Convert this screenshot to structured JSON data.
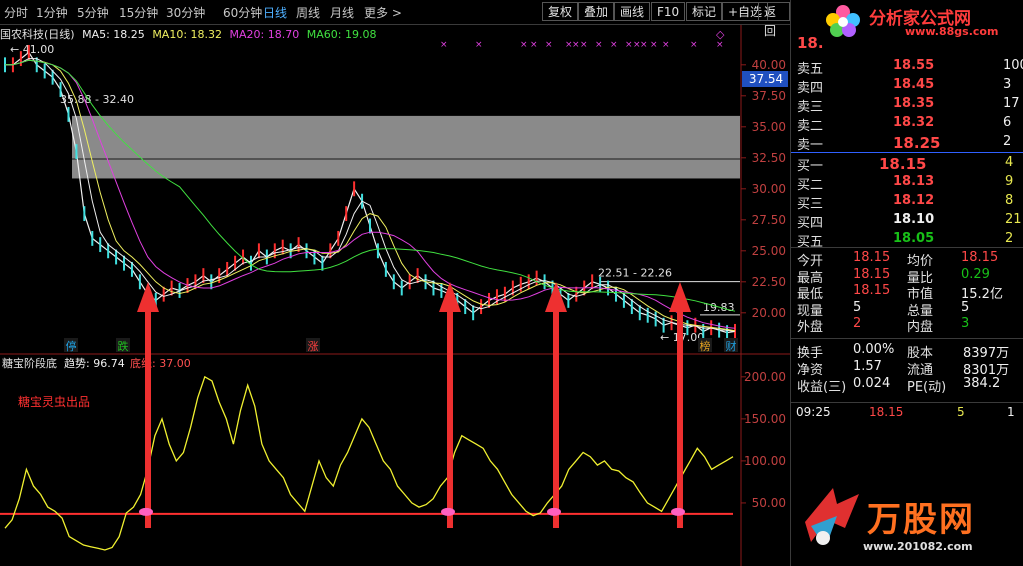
{
  "toolbar": {
    "periods": [
      "分时",
      "1分钟",
      "5分钟",
      "15分钟",
      "30分钟",
      "60分钟",
      "日线",
      "周线",
      "月线",
      "更多 >"
    ],
    "active_period": "日线",
    "buttons": [
      "复权",
      "叠加",
      "画线",
      "F10",
      "标记",
      "+自选",
      "返回"
    ]
  },
  "header": {
    "stock": "国农科技(日线)",
    "ma5": "MA5: 18.25",
    "ma10": "MA10: 18.32",
    "ma20": "MA20: 18.70",
    "ma60": "MA60: 19.08"
  },
  "price_axis": {
    "ticks": [
      "40.00",
      "37.50",
      "35.00",
      "32.50",
      "30.00",
      "27.50",
      "25.00",
      "22.50",
      "20.00"
    ],
    "current_price_tag": "37.54",
    "ylim": [
      17.0,
      42.0
    ]
  },
  "annotations": {
    "high": "41.00",
    "low": "17.00",
    "box_range": "35.88 - 32.40",
    "range2": "22.51 - 22.26",
    "last_high": "19.83",
    "markers": [
      "停",
      "跌",
      "涨",
      "榜",
      "财"
    ]
  },
  "indicator": {
    "title": "糖宝阶段底",
    "trend": "趋势: 96.74",
    "line": "底线: 37.00",
    "credit": "糖宝灵虫出品",
    "ticks": [
      "200.00",
      "150.00",
      "100.00",
      "50.00"
    ],
    "ylim": [
      -25,
      220
    ],
    "baseline": 37
  },
  "chart_data": {
    "type": "line",
    "series": [
      {
        "name": "趋势",
        "values": [
          20,
          30,
          55,
          90,
          70,
          60,
          45,
          40,
          32,
          10,
          5,
          0,
          -2,
          -4,
          -6,
          -3,
          10,
          38,
          45,
          60,
          90,
          130,
          150,
          120,
          100,
          110,
          140,
          175,
          200,
          195,
          170,
          150,
          120,
          160,
          190,
          165,
          120,
          100,
          90,
          80,
          60,
          50,
          40,
          70,
          100,
          80,
          70,
          95,
          110,
          130,
          150,
          140,
          120,
          100,
          90,
          70,
          60,
          50,
          45,
          48,
          55,
          70,
          80,
          110,
          130,
          125,
          120,
          115,
          100,
          90,
          75,
          60,
          50,
          40,
          35,
          38,
          50,
          60,
          70,
          90,
          100,
          110,
          105,
          95,
          100,
          90,
          88,
          80,
          75,
          62,
          50,
          45,
          40,
          55,
          70,
          85,
          100,
          115,
          105,
          90,
          95,
          100,
          105
        ]
      }
    ]
  },
  "logos": {
    "top_logo": "分析家公式网",
    "top_url": "www.88gs.com",
    "bottom_logo": "万股网",
    "bottom_url": "www.201082.com"
  },
  "orderbook": {
    "price_header": "18.",
    "asks": [
      {
        "label": "卖五",
        "price": "18.55",
        "vol": "100"
      },
      {
        "label": "卖四",
        "price": "18.45",
        "vol": "3"
      },
      {
        "label": "卖三",
        "price": "18.35",
        "vol": "17"
      },
      {
        "label": "卖二",
        "price": "18.32",
        "vol": "6"
      },
      {
        "label": "卖一",
        "price": "18.25",
        "vol": "2"
      }
    ],
    "bids": [
      {
        "label": "买一",
        "price": "18.15",
        "vol": "4"
      },
      {
        "label": "买二",
        "price": "18.13",
        "vol": "9"
      },
      {
        "label": "买三",
        "price": "18.12",
        "vol": "8"
      },
      {
        "label": "买四",
        "price": "18.10",
        "vol": "21"
      },
      {
        "label": "买五",
        "price": "18.05",
        "vol": "2"
      }
    ]
  },
  "quote": [
    {
      "l1": "今开",
      "v1": "18.15",
      "l2": "均价",
      "v2": "18.15"
    },
    {
      "l1": "最高",
      "v1": "18.15",
      "l2": "量比",
      "v2": "0.29"
    },
    {
      "l1": "最低",
      "v1": "18.15",
      "l2": "市值",
      "v2": "15.2亿"
    },
    {
      "l1": "现量",
      "v1": "5",
      "l2": "总量",
      "v2": "5"
    },
    {
      "l1": "外盘",
      "v1": "2",
      "l2": "内盘",
      "v2": "3"
    }
  ],
  "stats": [
    {
      "l1": "换手",
      "v1": "0.00%",
      "l2": "股本",
      "v2": "8397万"
    },
    {
      "l1": "净资",
      "v1": "1.57",
      "l2": "流通",
      "v2": "8301万"
    },
    {
      "l1": "收益(三)",
      "v1": "0.024",
      "l2": "PE(动)",
      "v2": "384.2"
    }
  ],
  "tick": {
    "time": "09:25",
    "price": "18.15",
    "vol": "5",
    "flag": "1"
  }
}
